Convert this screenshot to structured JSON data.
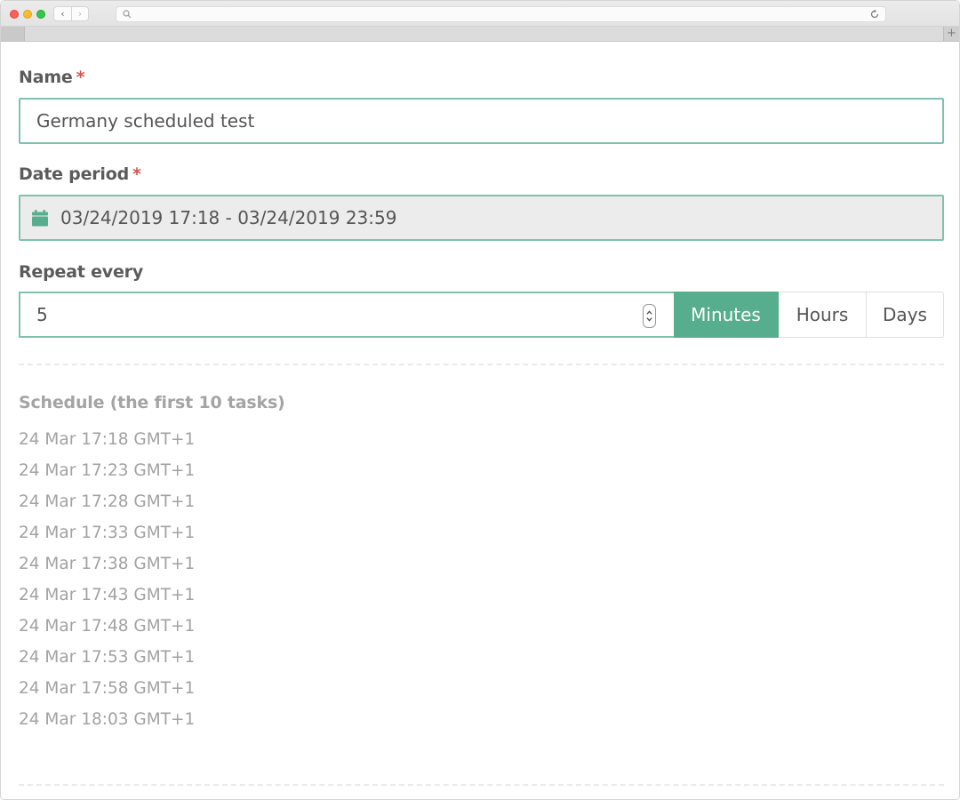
{
  "browser": {
    "back_label": "‹",
    "forward_label": "›",
    "new_tab_label": "+",
    "url_value": ""
  },
  "form": {
    "name": {
      "label": "Name",
      "required_marker": "*",
      "value": "Germany scheduled test"
    },
    "date_period": {
      "label": "Date period",
      "required_marker": "*",
      "icon": "calendar-icon",
      "value": "03/24/2019 17:18 - 03/24/2019 23:59"
    },
    "repeat_every": {
      "label": "Repeat every",
      "value": "5",
      "units": [
        {
          "label": "Minutes",
          "active": true
        },
        {
          "label": "Hours",
          "active": false
        },
        {
          "label": "Days",
          "active": false
        }
      ]
    }
  },
  "schedule": {
    "title": "Schedule (the first 10 tasks)",
    "items": [
      "24 Mar 17:18 GMT+1",
      "24 Mar 17:23 GMT+1",
      "24 Mar 17:28 GMT+1",
      "24 Mar 17:33 GMT+1",
      "24 Mar 17:38 GMT+1",
      "24 Mar 17:43 GMT+1",
      "24 Mar 17:48 GMT+1",
      "24 Mar 17:53 GMT+1",
      "24 Mar 17:58 GMT+1",
      "24 Mar 18:03 GMT+1"
    ]
  },
  "colors": {
    "accent": "#57ae8e",
    "field_border": "#7ec3a9",
    "required": "#d9534f",
    "label_text": "#5b5b5b",
    "muted_text": "#a2a2a2"
  }
}
